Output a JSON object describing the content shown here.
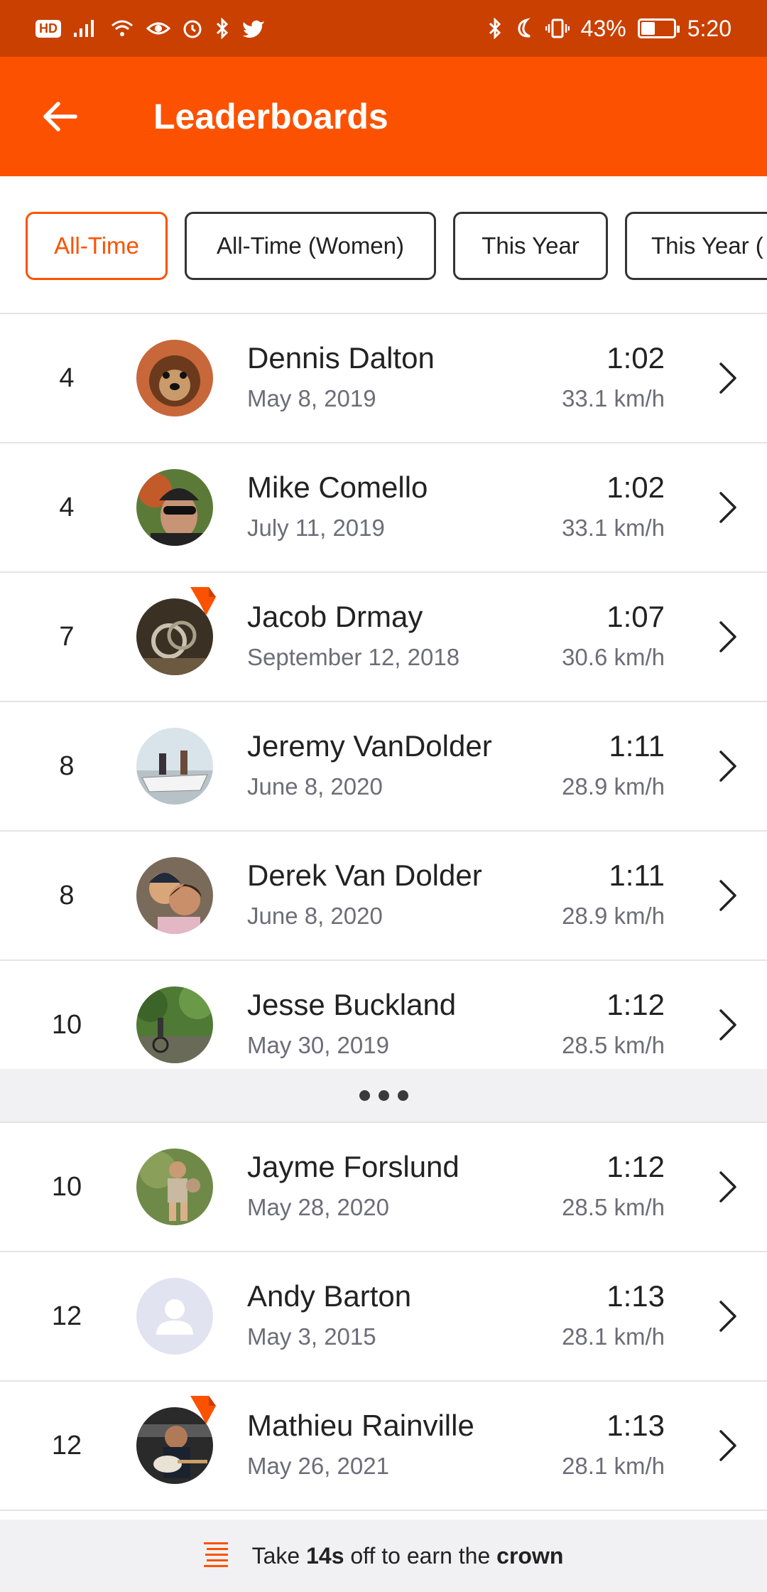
{
  "status_bar": {
    "hd": "HD",
    "battery_text": "43%",
    "battery_level": 0.43,
    "time": "5:20",
    "icons_left": [
      "signal-icon",
      "wifi-icon",
      "eye-icon",
      "alarm-icon",
      "bluetooth-icon",
      "twitter-icon"
    ],
    "icons_right": [
      "bluetooth-icon",
      "moon-icon",
      "vibrate-icon",
      "battery-icon"
    ]
  },
  "header": {
    "title": "Leaderboards",
    "back_icon": "arrow-left-icon"
  },
  "filters": [
    {
      "label": "All-Time",
      "active": true
    },
    {
      "label": "All-Time (Women)",
      "active": false
    },
    {
      "label": "This Year",
      "active": false
    },
    {
      "label": "This Year (",
      "active": false
    }
  ],
  "rows_top": [
    {
      "rank": "4",
      "name": "Dennis Dalton",
      "date": "May 8, 2019",
      "time": "1:02",
      "speed": "33.1 km/h",
      "avatar": "dog",
      "badge": false
    },
    {
      "rank": "4",
      "name": "Mike Comello",
      "date": "July 11, 2019",
      "time": "1:02",
      "speed": "33.1 km/h",
      "avatar": "helmet",
      "badge": false
    },
    {
      "rank": "7",
      "name": "Jacob Drmay",
      "date": "September 12, 2018",
      "time": "1:07",
      "speed": "30.6 km/h",
      "avatar": "rings",
      "badge": true
    },
    {
      "rank": "8",
      "name": "Jeremy VanDolder",
      "date": "June 8, 2020",
      "time": "1:11",
      "speed": "28.9 km/h",
      "avatar": "boat",
      "badge": false
    },
    {
      "rank": "8",
      "name": "Derek Van Dolder",
      "date": "June 8, 2020",
      "time": "1:11",
      "speed": "28.9 km/h",
      "avatar": "couple",
      "badge": false
    },
    {
      "rank": "10",
      "name": "Jesse Buckland",
      "date": "May 30, 2019",
      "time": "1:12",
      "speed": "28.5 km/h",
      "avatar": "forest",
      "badge": false
    }
  ],
  "rows_bottom": [
    {
      "rank": "10",
      "name": "Jayme Forslund",
      "date": "May 28, 2020",
      "time": "1:12",
      "speed": "28.5 km/h",
      "avatar": "hiker",
      "badge": false
    },
    {
      "rank": "12",
      "name": "Andy Barton",
      "date": "May 3, 2015",
      "time": "1:13",
      "speed": "28.1 km/h",
      "avatar": "default",
      "badge": false
    },
    {
      "rank": "12",
      "name": "Mathieu Rainville",
      "date": "May 26, 2021",
      "time": "1:13",
      "speed": "28.1 km/h",
      "avatar": "guitar",
      "badge": true
    }
  ],
  "crown_bar": {
    "icon": "leaderboard-list-icon",
    "prefix": "Take ",
    "seconds": "14s",
    "middle": " off to earn the ",
    "crown": "crown"
  },
  "colors": {
    "brand": "#fc5200",
    "status_bar": "#c94000"
  }
}
